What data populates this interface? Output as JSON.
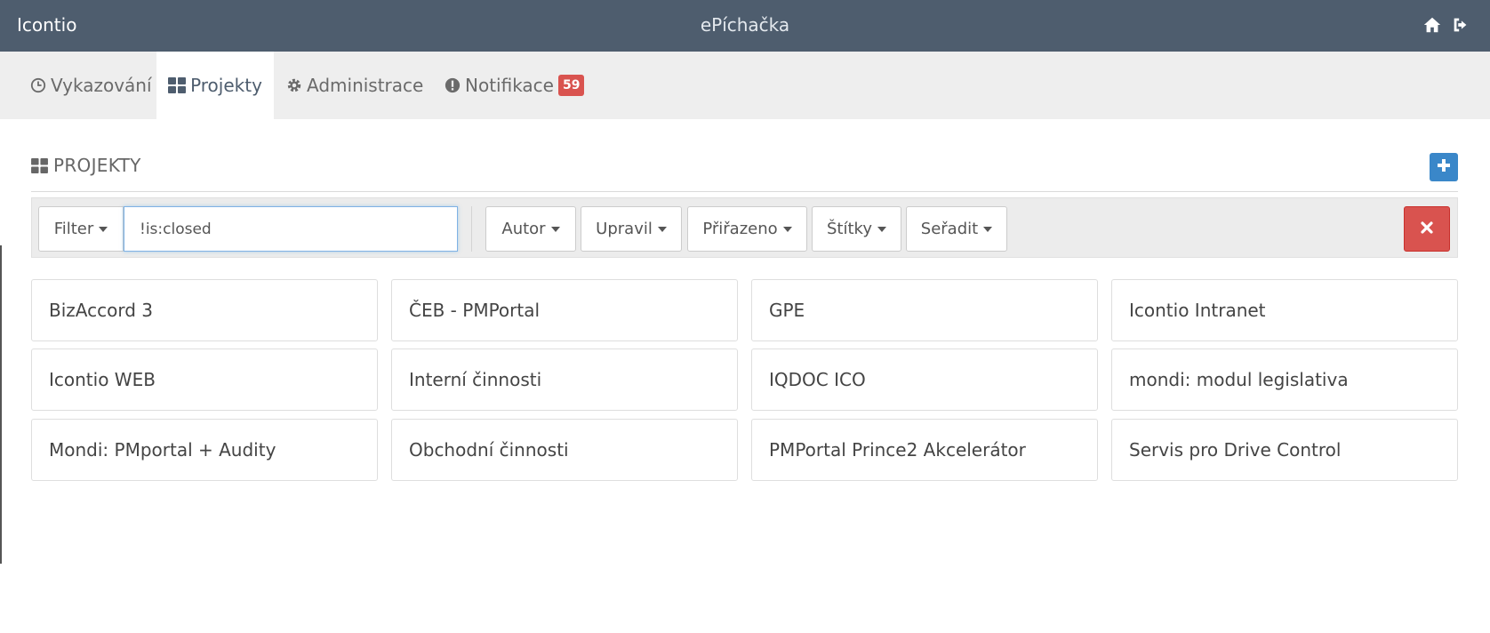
{
  "header": {
    "brand": "Icontio",
    "app_title": "ePíchačka",
    "home_icon": "home-icon",
    "logout_icon": "sign-out-icon"
  },
  "nav": {
    "items": [
      {
        "label": "Vykazování",
        "icon": "clock-icon"
      },
      {
        "label": "Projekty",
        "icon": "dashboard-grid-icon",
        "active": true
      },
      {
        "label": "Administrace",
        "icon": "gear-icon"
      },
      {
        "label": "Notifikace",
        "icon": "exclamation-circle-icon",
        "badge": "59"
      }
    ]
  },
  "section": {
    "title": "PROJEKTY",
    "add_icon": "plus-icon"
  },
  "filter": {
    "filter_label": "Filter",
    "value": "!is:closed",
    "buttons": [
      "Autor",
      "Upravil",
      "Přiřazeno",
      "Štítky",
      "Seřadit"
    ],
    "clear_icon": "close-icon"
  },
  "projects": [
    "BizAccord 3",
    "ČEB - PMPortal",
    "GPE",
    "Icontio Intranet",
    "Icontio WEB",
    "Interní činnosti",
    "IQDOC ICO",
    "mondi: modul legislativa",
    "Mondi: PMportal + Audity",
    "Obchodní činnosti",
    "PMPortal Prince2 Akcelerátor",
    "Servis pro Drive Control"
  ],
  "colors": {
    "topbar": "#4e5d6e",
    "badge": "#d9534f",
    "add_button": "#3a87c9",
    "clear_button": "#d9534f"
  }
}
